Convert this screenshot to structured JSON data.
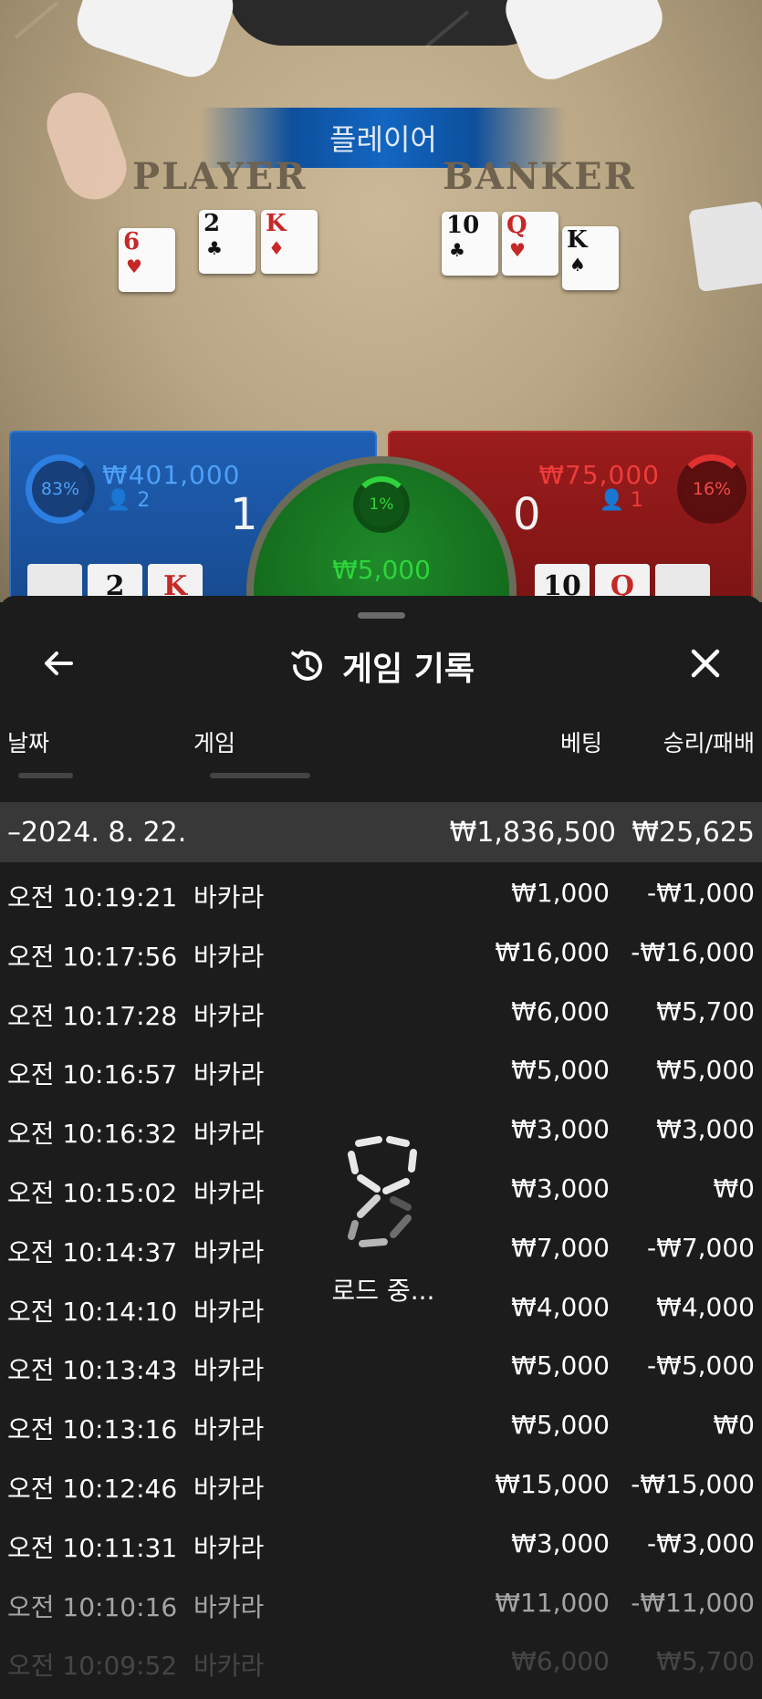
{
  "table": {
    "result_banner": "플레이어",
    "player_label": "PLAYER",
    "banker_label": "BANKER",
    "player_cards": [
      {
        "rank": "6",
        "suit": "♥",
        "color": "red"
      },
      {
        "rank": "2",
        "suit": "♣",
        "color": "black"
      },
      {
        "rank": "K",
        "suit": "♦",
        "color": "red"
      }
    ],
    "banker_cards": [
      {
        "rank": "10",
        "suit": "♣",
        "color": "black"
      },
      {
        "rank": "Q",
        "suit": "♥",
        "color": "red"
      },
      {
        "rank": "K",
        "suit": "♠",
        "color": "black"
      }
    ]
  },
  "bets": {
    "player": {
      "percent": "83%",
      "amount": "₩401,000",
      "players": "2",
      "score": "1",
      "cards": [
        "",
        "2",
        "K"
      ]
    },
    "banker": {
      "percent": "16%",
      "amount": "₩75,000",
      "players": "1",
      "score": "0",
      "cards": [
        "10",
        "Q",
        ""
      ]
    },
    "tie": {
      "percent": "1%",
      "amount": "₩5,000"
    }
  },
  "history": {
    "title": "게임 기록",
    "columns": {
      "date": "날짜",
      "game": "게임",
      "bet": "베팅",
      "result": "승리/패배"
    },
    "day_summary": {
      "date": "–2024. 8. 22.",
      "bet": "₩1,836,500",
      "result": "₩25,625"
    },
    "rows": [
      {
        "time": "오전 10:19:21",
        "game": "바카라",
        "bet": "₩1,000",
        "result": "-₩1,000"
      },
      {
        "time": "오전 10:17:56",
        "game": "바카라",
        "bet": "₩16,000",
        "result": "-₩16,000"
      },
      {
        "time": "오전 10:17:28",
        "game": "바카라",
        "bet": "₩6,000",
        "result": "₩5,700"
      },
      {
        "time": "오전 10:16:57",
        "game": "바카라",
        "bet": "₩5,000",
        "result": "₩5,000"
      },
      {
        "time": "오전 10:16:32",
        "game": "바카라",
        "bet": "₩3,000",
        "result": "₩3,000"
      },
      {
        "time": "오전 10:15:02",
        "game": "바카라",
        "bet": "₩3,000",
        "result": "₩0"
      },
      {
        "time": "오전 10:14:37",
        "game": "바카라",
        "bet": "₩7,000",
        "result": "-₩7,000"
      },
      {
        "time": "오전 10:14:10",
        "game": "바카라",
        "bet": "₩4,000",
        "result": "₩4,000"
      },
      {
        "time": "오전 10:13:43",
        "game": "바카라",
        "bet": "₩5,000",
        "result": "-₩5,000"
      },
      {
        "time": "오전 10:13:16",
        "game": "바카라",
        "bet": "₩5,000",
        "result": "₩0"
      },
      {
        "time": "오전 10:12:46",
        "game": "바카라",
        "bet": "₩15,000",
        "result": "-₩15,000"
      },
      {
        "time": "오전 10:11:31",
        "game": "바카라",
        "bet": "₩3,000",
        "result": "-₩3,000"
      },
      {
        "time": "오전 10:10:16",
        "game": "바카라",
        "bet": "₩11,000",
        "result": "-₩11,000"
      },
      {
        "time": "오전 10:09:52",
        "game": "바카라",
        "bet": "₩6,000",
        "result": "₩5,700"
      }
    ],
    "loading_label": "로드 중..."
  },
  "icons": {
    "back": "arrow-left-icon",
    "history": "history-clock-icon",
    "close": "close-x-icon",
    "loading": "loading-spinner-icon",
    "user": "user-icon"
  },
  "colors": {
    "player_blue": "#1f5fb4",
    "banker_red": "#9c1c1c",
    "tie_green": "#1f8a2a",
    "sheet_bg": "#1c1c1c",
    "day_row_bg": "#383838"
  }
}
